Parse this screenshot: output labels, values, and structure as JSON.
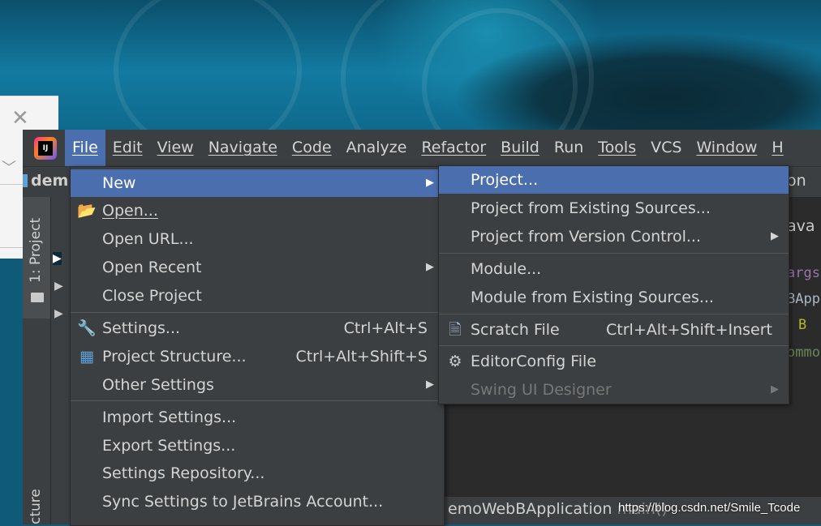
{
  "menubar": {
    "items": [
      {
        "label": "File",
        "active": true
      },
      {
        "label": "Edit"
      },
      {
        "label": "View"
      },
      {
        "label": "Navigate"
      },
      {
        "label": "Code"
      },
      {
        "label": "Analyze"
      },
      {
        "label": "Refactor"
      },
      {
        "label": "Build"
      },
      {
        "label": "Run"
      },
      {
        "label": "Tools"
      },
      {
        "label": "VCS"
      },
      {
        "label": "Window"
      },
      {
        "label": "H"
      }
    ]
  },
  "toolbar": {
    "project_name": "dem",
    "run_config": "on"
  },
  "sidebar": {
    "project_tab": "1: Project",
    "structure_tab": "cture"
  },
  "editor": {
    "tab": "ava",
    "code_lines": [
      "args",
      "BApp",
      "B",
      "ommo"
    ]
  },
  "status": {
    "text": "emoWebBApplication",
    "suffix": "main()"
  },
  "file_menu": {
    "items": [
      {
        "label": "New",
        "arrow": "▶",
        "active": true
      },
      {
        "label": "Open...",
        "icon": "folder-open-icon"
      },
      {
        "label": "Open URL..."
      },
      {
        "label": "Open Recent",
        "arrow": "▶"
      },
      {
        "label": "Close Project"
      },
      {
        "label": "Settings...",
        "shortcut": "Ctrl+Alt+S",
        "icon": "wrench-icon"
      },
      {
        "label": "Project Structure...",
        "shortcut": "Ctrl+Alt+Shift+S",
        "icon": "project-structure-icon"
      },
      {
        "label": "Other Settings",
        "arrow": "▶"
      },
      {
        "label": "Import Settings..."
      },
      {
        "label": "Export Settings..."
      },
      {
        "label": "Settings Repository..."
      },
      {
        "label": "Sync Settings to JetBrains Account..."
      }
    ]
  },
  "new_submenu": {
    "items": [
      {
        "label": "Project...",
        "active": true
      },
      {
        "label": "Project from Existing Sources..."
      },
      {
        "label": "Project from Version Control...",
        "arrow": "▶"
      },
      {
        "label": "Module..."
      },
      {
        "label": "Module from Existing Sources..."
      },
      {
        "label": "Scratch File",
        "shortcut": "Ctrl+Alt+Shift+Insert",
        "icon": "scratch-file-icon"
      },
      {
        "label": "EditorConfig File",
        "icon": "gear-icon"
      },
      {
        "label": "Swing UI Designer",
        "arrow": "▶",
        "disabled": true
      }
    ]
  },
  "watermark": "https://blog.csdn.net/Smile_Tcode",
  "colors": {
    "accent": "#4b6eaf",
    "menu_bg": "#3c3f41",
    "editor_bg": "#2b2b2b"
  }
}
